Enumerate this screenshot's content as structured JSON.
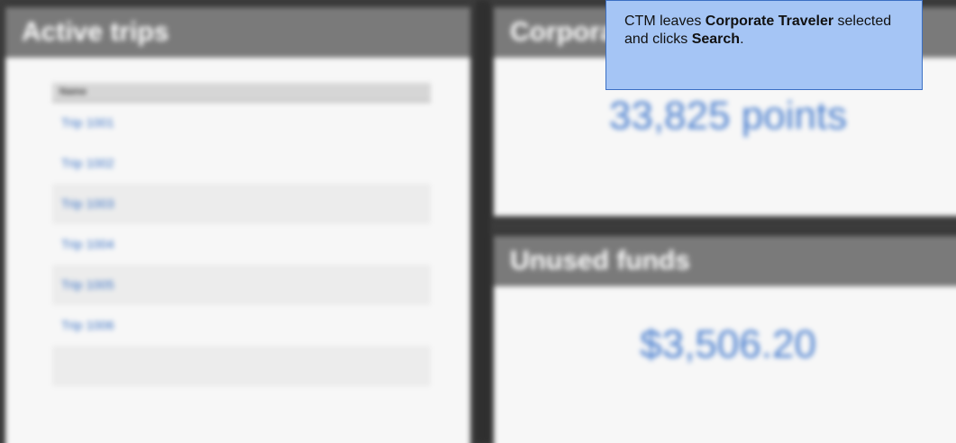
{
  "background": {
    "active_trips": {
      "title": "Active trips",
      "column_header": "Name",
      "rows": [
        "Trip 1001",
        "Trip 1002",
        "Trip 1003",
        "Trip 1004",
        "Trip 1005",
        "Trip 1006",
        ""
      ]
    },
    "corporate": {
      "title": "Corporate",
      "value": "33,825 points"
    },
    "unused_funds": {
      "title": "Unused funds",
      "value": "$3,506.20"
    }
  },
  "callout": {
    "part1": "CTM leaves ",
    "bold1": "Corporate Traveler",
    "part2": " selected and clicks ",
    "bold2": "Search",
    "part3": "."
  },
  "colors": {
    "callout_bg": "#a5c5f5",
    "callout_border": "#3b6fc4",
    "link": "#3a72c4",
    "header_bg": "#7a7a7a"
  }
}
